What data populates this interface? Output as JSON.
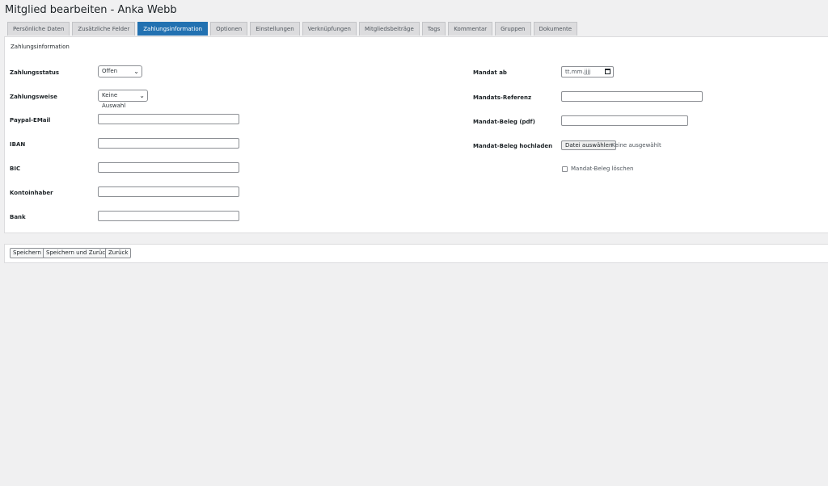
{
  "page": {
    "title": "Mitglied bearbeiten - Anka Webb"
  },
  "tabs": [
    {
      "label": "Persönliche Daten"
    },
    {
      "label": "Zusätzliche Felder"
    },
    {
      "label": "Zahlungsinformation",
      "active": true
    },
    {
      "label": "Optionen"
    },
    {
      "label": "Einstellungen"
    },
    {
      "label": "Verknüpfungen"
    },
    {
      "label": "Mitgliedsbeiträge"
    },
    {
      "label": "Tags"
    },
    {
      "label": "Kommentar"
    },
    {
      "label": "Gruppen"
    },
    {
      "label": "Dokumente"
    }
  ],
  "section": {
    "title": "Zahlungsinformation"
  },
  "left": {
    "zahlungsstatus": {
      "label": "Zahlungsstatus",
      "value": "Offen"
    },
    "zahlungsweise": {
      "label": "Zahlungsweise",
      "value": "Keine Auswahl"
    },
    "paypal": {
      "label": "Paypal-EMail",
      "value": ""
    },
    "iban": {
      "label": "IBAN",
      "value": ""
    },
    "bic": {
      "label": "BIC",
      "value": ""
    },
    "kontoinhaber": {
      "label": "Kontoinhaber",
      "value": ""
    },
    "bank": {
      "label": "Bank",
      "value": ""
    }
  },
  "right": {
    "mandat_ab": {
      "label": "Mandat ab",
      "placeholder": "tt.mm.jjjj"
    },
    "mandats_referenz": {
      "label": "Mandats-Referenz",
      "value": ""
    },
    "mandat_beleg_pdf": {
      "label": "Mandat-Beleg (pdf)",
      "value": ""
    },
    "mandat_beleg_upload": {
      "label": "Mandat-Beleg hochladen",
      "button": "Datei auswählen",
      "status": "Keine ausgewählt"
    },
    "mandat_beleg_loeschen": {
      "label": "Mandat-Beleg löschen",
      "checked": false
    }
  },
  "actions": {
    "save": "Speichern",
    "save_back": "Speichern und Zurück",
    "back": "Zurück"
  },
  "colors": {
    "accent": "#2271b1",
    "background": "#f0f0f1"
  }
}
